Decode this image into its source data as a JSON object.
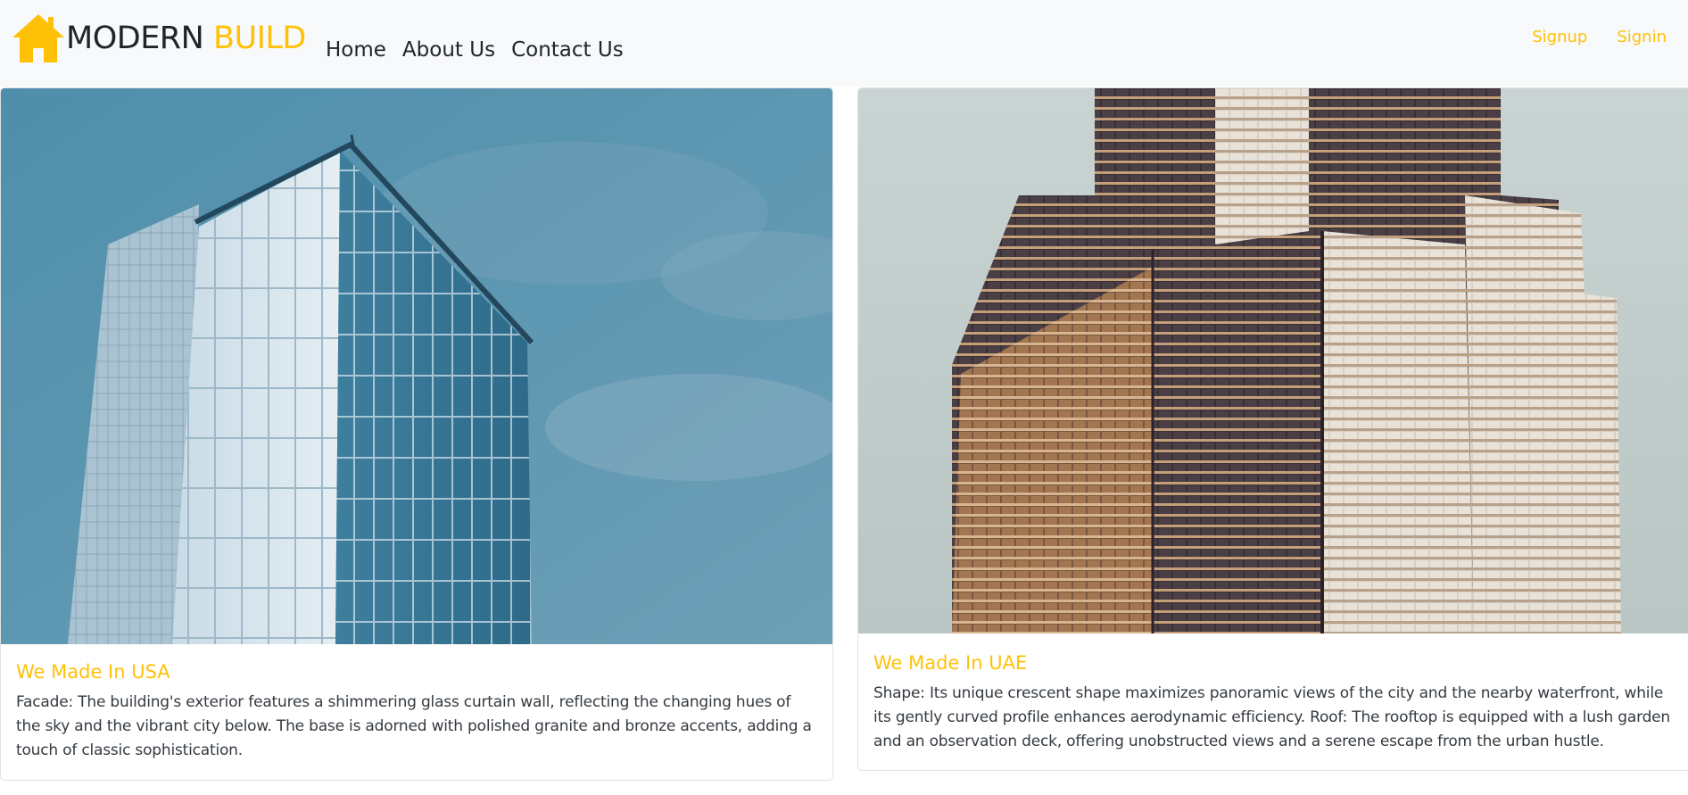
{
  "navbar": {
    "brand": {
      "word1": "MODERN",
      "word2": "BUILD",
      "icon": "house-icon"
    },
    "links": [
      "Home",
      "About Us",
      "Contact Us"
    ],
    "auth": {
      "signup": "Signup",
      "signin": "Signin"
    }
  },
  "cards": [
    {
      "title": "We Made In USA",
      "text": "Facade: The building's exterior features a shimmering glass curtain wall, reflecting the changing hues of the sky and the vibrant city below. The base is adorned with polished granite and bronze accents, adding a touch of classic sophistication."
    },
    {
      "title": "We Made In UAE",
      "text": "Shape: Its unique crescent shape maximizes panoramic views of the city and the nearby waterfront, while its gently curved profile enhances aerodynamic efficiency. Roof: The rooftop is equipped with a lush garden and an observation deck, offering unobstructed views and a serene escape from the urban hustle."
    }
  ],
  "colors": {
    "accent": "#ffc107",
    "navbar_bg": "#f8f9fa",
    "text": "#212529"
  }
}
